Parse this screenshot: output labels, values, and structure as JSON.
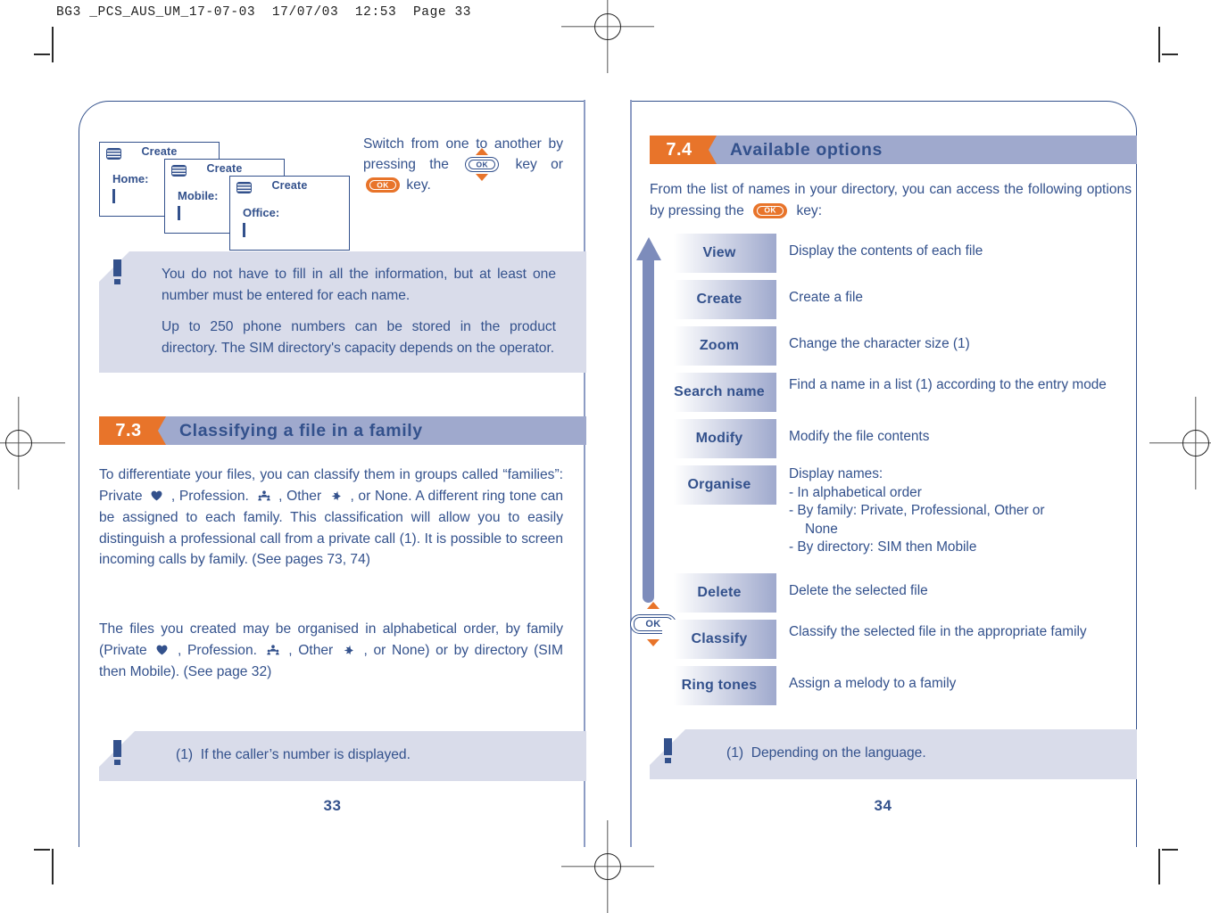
{
  "print_header": "BG3 _PCS_AUS_UM_17-07-03  17/07/03  12:53  Page 33",
  "left_page": {
    "page_number": "33",
    "screens": [
      {
        "sim_icon": "sim-card-icon",
        "title": "Create",
        "field": "Home:"
      },
      {
        "sim_icon": "sim-card-icon",
        "title": "Create",
        "field": "Mobile:"
      },
      {
        "sim_icon": "sim-card-icon",
        "title": "Create",
        "field": "Office:"
      }
    ],
    "side_text": {
      "part1": "Switch from one to another by pressing the",
      "key1_label": "OK",
      "part2": "key or",
      "key2_label": "OK",
      "part3": "key."
    },
    "note": {
      "icon": "exclamation-icon",
      "paragraphs": [
        "You do not have to fill in all the information, but at least one number must be entered for each name.",
        "Up to 250 phone numbers can be stored in the product directory. The SIM directory's capacity depends on the operator."
      ]
    },
    "section": {
      "number": "7.3",
      "title": "Classifying a file in a family"
    },
    "body": {
      "p1_a": "To differentiate your files, you can classify them in groups called “families”: Private",
      "p1_b": ", Profession.",
      "p1_c": ", Other",
      "p1_d": ",  or None.  A different ring tone can be assigned to each family. This classification will allow you to easily distinguish a professional call from a private call (1). It is possible to screen incoming calls by family. (See pages 73, 74)",
      "p2_a": "The files you created may be organised in alphabetical order, by family (Private",
      "p2_b": ", Profession.",
      "p2_c": ", Other",
      "p2_d": ", or None) or by directory (SIM then Mobile). (See page 32)"
    },
    "footnote": {
      "icon": "exclamation-icon",
      "marker": "(1)",
      "text": "If the caller’s number is displayed."
    }
  },
  "right_page": {
    "page_number": "34",
    "section": {
      "number": "7.4",
      "title": "Available options"
    },
    "intro": {
      "part1": "From the list of names in your directory, you can access the following options by pressing the",
      "key_label": "OK",
      "part2": "key:"
    },
    "nav_control": {
      "up_arrow": "up-arrow-icon",
      "down_arrow": "down-arrow-icon",
      "ok_label": "OK",
      "scroll_arrow": "scroll-up-arrow-icon"
    },
    "options": [
      {
        "label": "View",
        "description": "Display the contents of each file"
      },
      {
        "label": "Create",
        "description": "Create a file"
      },
      {
        "label": "Zoom",
        "description": "Change the character size (1)"
      },
      {
        "label": "Search name",
        "description": "Find a name in a list (1) according to the entry mode",
        "justify": true
      },
      {
        "label": "Modify",
        "description": "Modify the file contents"
      },
      {
        "label": "Organise",
        "description_lines": [
          "Display names:",
          "- In alphabetical order",
          "- By family: Private, Professional, Other or",
          "None",
          "- By directory: SIM then Mobile"
        ]
      },
      {
        "label": "Delete",
        "description": "Delete the selected file"
      },
      {
        "label": "Classify",
        "description": "Classify the selected file in the appropriate family",
        "justify": true
      },
      {
        "label": "Ring tones",
        "description": "Assign a melody to a family"
      }
    ],
    "footnote": {
      "icon": "exclamation-icon",
      "marker": "(1)",
      "text": "Depending on the language."
    }
  },
  "colors": {
    "brand_blue": "#33518c",
    "accent_orange": "#e8742a",
    "header_bar": "#9fa9cd",
    "note_bg": "#d9dcea",
    "arrow_blue": "#7d8cbb"
  }
}
